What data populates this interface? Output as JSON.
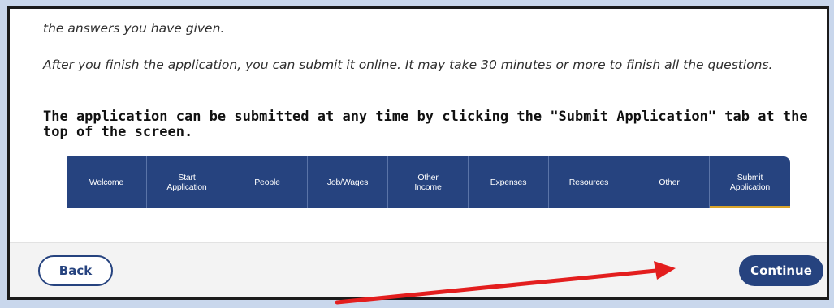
{
  "intro": {
    "line1": "the answers you have given.",
    "line2": "After you finish the application, you can submit it online. It may take 30 minutes or more to finish all the questions."
  },
  "notice": "The application can be submitted at any time by clicking the \"Submit Application\" tab at the top of the screen.",
  "tabs": [
    {
      "label": "Welcome"
    },
    {
      "label": "Start\nApplication"
    },
    {
      "label": "People"
    },
    {
      "label": "Job/Wages"
    },
    {
      "label": "Other\nIncome"
    },
    {
      "label": "Expenses"
    },
    {
      "label": "Resources"
    },
    {
      "label": "Other"
    },
    {
      "label": "Submit\nApplication"
    }
  ],
  "footer": {
    "back_label": "Back",
    "continue_label": "Continue"
  },
  "colors": {
    "brand": "#26437f",
    "active_tab_underline": "#d9a42a",
    "annotation_arrow": "#e31e1e"
  }
}
